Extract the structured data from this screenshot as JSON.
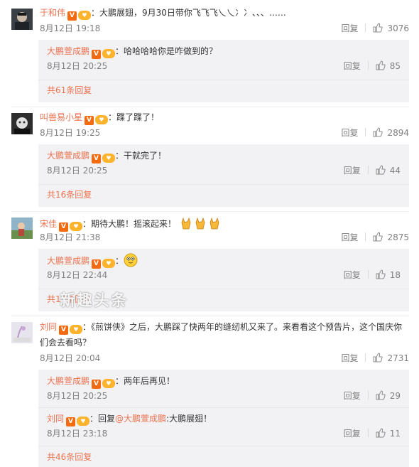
{
  "colors": {
    "link": "#eb7350",
    "meta": "#808080",
    "reply_bg": "#f2f2f5",
    "v_badge": "#f46b0f"
  },
  "labels": {
    "reply": "回复",
    "verified": "V"
  },
  "comments": [
    {
      "user": "于和伟",
      "text": "大鹏展翅，9月30日带你飞飞飞乀乀冫冫、、、……",
      "time": "8月12日 19:18",
      "likes": "3076",
      "replies": [
        {
          "user": "大鹏萱成鹏",
          "text": "哈哈哈哈你是咋做到的？",
          "time": "8月12日 20:25",
          "likes": "85"
        }
      ],
      "more": "共61条回复"
    },
    {
      "user": "叫兽易小星",
      "text": "蹀了蹀了！",
      "time": "8月12日 19:25",
      "likes": "2894",
      "replies": [
        {
          "user": "大鹏萱成鹏",
          "text": "干就完了！",
          "time": "8月12日 20:25",
          "likes": "44"
        }
      ],
      "more": "共16条回复"
    },
    {
      "user": "宋佳",
      "text": "期待大鹏！摇滚起来！",
      "time": "8月12日 21:38",
      "likes": "2875",
      "replies": [
        {
          "user": "大鹏萱成鹏",
          "text": "",
          "time": "8月12日 22:44",
          "likes": "18"
        }
      ],
      "more": "共13条回复"
    },
    {
      "user": "刘同",
      "text": "《煎饼侠》之后，大鹏踩了快两年的缝纫机又来了。来看看这个预告片，这个国庆你们会去看吗？",
      "time": "8月12日 20:04",
      "likes": "2731",
      "replies": [
        {
          "user": "大鹏萱成鹏",
          "text": "两年后再见！",
          "time": "8月12日 20:25",
          "likes": "29"
        },
        {
          "user": "刘同",
          "reply_prefix": "回复",
          "mention": "@大鹏萱成鹏",
          "text": ":大鹏展翅！",
          "time": "8月12日 23:18",
          "likes": "11"
        }
      ],
      "more": "共46条回复"
    }
  ],
  "watermark": "新趣头条"
}
